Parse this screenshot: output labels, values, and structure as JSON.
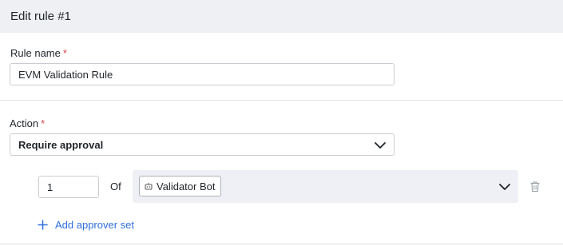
{
  "header": {
    "title": "Edit rule #1"
  },
  "rule_name": {
    "label": "Rule name",
    "required_mark": "*",
    "value": "EVM Validation Rule"
  },
  "action": {
    "label": "Action",
    "required_mark": "*",
    "selected": "Require approval"
  },
  "approver_set": {
    "count": "1",
    "of_label": "Of",
    "approvers": [
      "Validator Bot"
    ]
  },
  "add_approver_set": {
    "label": "Add approver set"
  },
  "colors": {
    "header_bg": "#eef0f3",
    "required": "#d64545",
    "link": "#2f6fe0",
    "approver_row_bg": "#eef0f5"
  },
  "icons": {
    "chevron": "chevron-down-icon",
    "trash": "trash-icon",
    "bot": "bot-icon",
    "plus": "plus-icon"
  }
}
